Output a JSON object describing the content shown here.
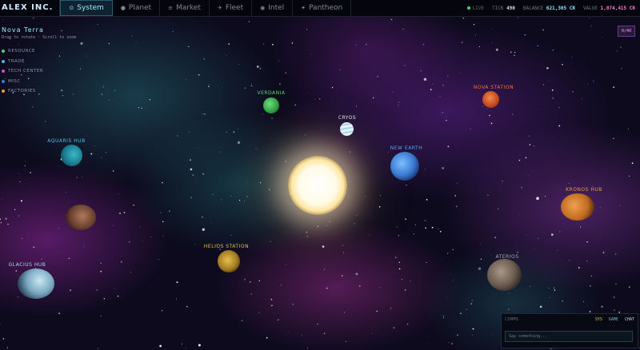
{
  "app": {
    "brand": "ALEX INC."
  },
  "nav": {
    "tabs": [
      {
        "label": "System",
        "icon": "system-icon",
        "active": true
      },
      {
        "label": "Planet",
        "icon": "planet-icon",
        "active": false
      },
      {
        "label": "Market",
        "icon": "market-icon",
        "active": false
      },
      {
        "label": "Fleet",
        "icon": "fleet-icon",
        "active": false
      },
      {
        "label": "Intel",
        "icon": "intel-icon",
        "active": false
      },
      {
        "label": "Pantheon",
        "icon": "pantheon-icon",
        "active": false
      }
    ]
  },
  "status": {
    "live_label": "LIVE",
    "tick_label": "TICK",
    "tick_value": "490",
    "balance_label": "BALANCE",
    "balance_value": "621,305 CR",
    "value_label": "VALUE",
    "value_value": "1,074,415 CR"
  },
  "system": {
    "name": "Nova Terra",
    "hint": "Drag to rotate · Scroll to zoom",
    "zoom": "0/40"
  },
  "legend": [
    {
      "label": "RESOURCE",
      "color": "#4ad27a"
    },
    {
      "label": "TRADE",
      "color": "#4ab8e0"
    },
    {
      "label": "TECH CENTER",
      "color": "#d04ad0"
    },
    {
      "label": "MISC",
      "color": "#3a7ad0"
    },
    {
      "label": "FACTORIES",
      "color": "#e0a040"
    }
  ],
  "planets": [
    {
      "name": "VERDANIA",
      "label_color": "#5ad47a"
    },
    {
      "name": "CRYOS",
      "label_color": "#d8e6f0"
    },
    {
      "name": "NOVA STATION",
      "label_color": "#e87a3a"
    },
    {
      "name": "AQUARIS HUB",
      "label_color": "#4ac0e8"
    },
    {
      "name": "NEW EARTH",
      "label_color": "#4aa8f0"
    },
    {
      "name": "KRONOS HUB",
      "label_color": "#e89a40"
    },
    {
      "name": "HELIOS STATION",
      "label_color": "#e8c040"
    },
    {
      "name": "GLACIUS HUB",
      "label_color": "#a8d8f0"
    },
    {
      "name": "ATERIOS",
      "label_color": "#a8a8a8"
    },
    {
      "name": "",
      "label_color": "#a0a0a0"
    }
  ],
  "comms": {
    "title": "COMMS",
    "tabs": [
      "SYS",
      "GAME",
      "CHAT"
    ],
    "placeholder": "Say something..."
  }
}
